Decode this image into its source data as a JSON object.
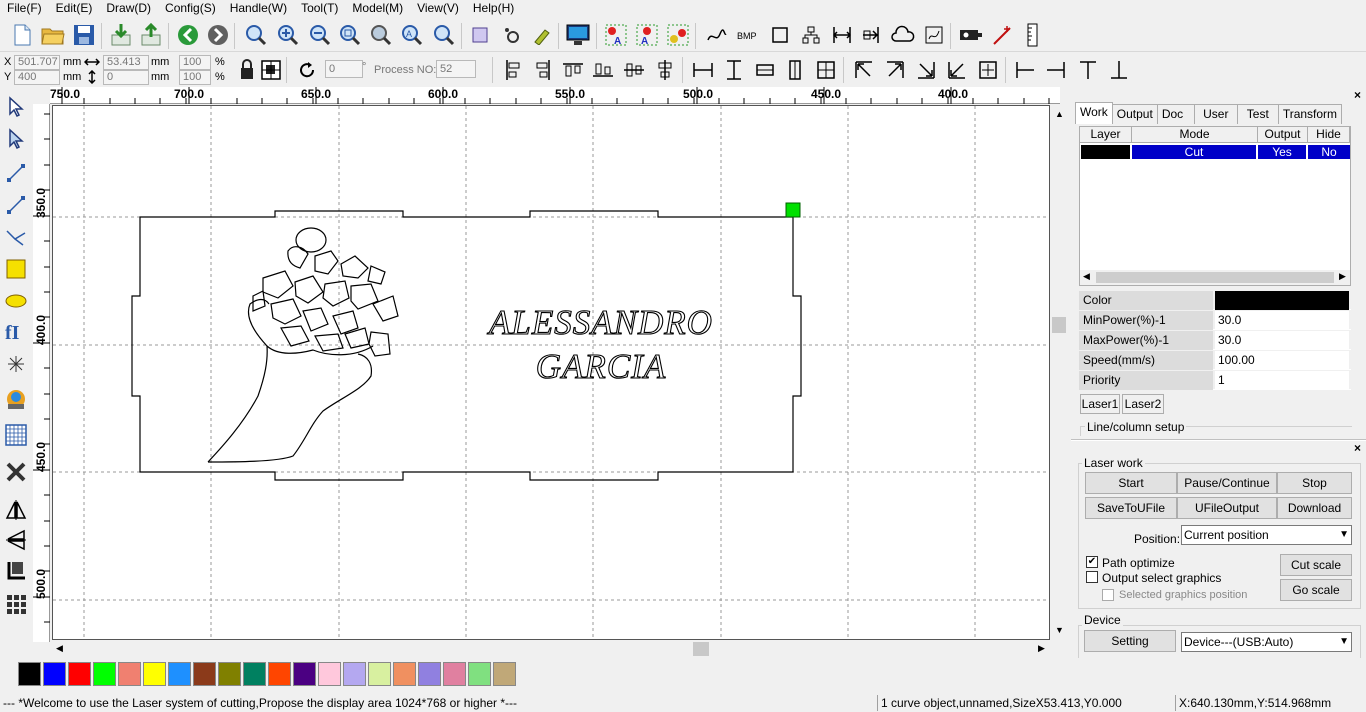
{
  "menu": [
    "File(F)",
    "Edit(E)",
    "Draw(D)",
    "Config(S)",
    "Handle(W)",
    "Tool(T)",
    "Model(M)",
    "View(V)",
    "Help(H)"
  ],
  "toolbar2": {
    "x_label": "X",
    "x_value": "501.707",
    "x_unit": "mm",
    "y_label": "Y",
    "y_value": "400",
    "y_unit": "mm",
    "w_value": "53.413",
    "w_unit": "mm",
    "h_value": "0",
    "h_unit": "mm",
    "w_percent": "100",
    "h_percent": "100",
    "percent_sign": "%",
    "rotate_value": "0",
    "degree_sign": "°",
    "process_label": "Process NO:",
    "process_value": "52"
  },
  "ruler": {
    "h_labels": [
      "750.0",
      "700.0",
      "650.0",
      "600.0",
      "550.0",
      "500.0",
      "450.0",
      "400.0"
    ],
    "v_labels": [
      "350.0",
      "400.0",
      "450.0",
      "500.0"
    ]
  },
  "design": {
    "line1": "ALESSANDRO",
    "line2": "GARCIA"
  },
  "panel": {
    "tabs": [
      "Work",
      "Output",
      "Doc",
      "User",
      "Test",
      "Transform"
    ],
    "layer_headers": [
      "Layer",
      "Mode",
      "Output",
      "Hide"
    ],
    "layer_row": {
      "color": "#000000",
      "mode": "Cut",
      "output": "Yes",
      "hide": "No"
    },
    "props": [
      {
        "k": "Color",
        "v": ""
      },
      {
        "k": "MinPower(%)-1",
        "v": "30.0"
      },
      {
        "k": "MaxPower(%)-1",
        "v": "30.0"
      },
      {
        "k": "Speed(mm/s)",
        "v": "100.00"
      },
      {
        "k": "Priority",
        "v": "1"
      }
    ],
    "laser_tabs": [
      "Laser1",
      "Laser2"
    ],
    "line_column": "Line/column setup",
    "laser_work": "Laser work",
    "btn_start": "Start",
    "btn_pause": "Pause/Continue",
    "btn_stop": "Stop",
    "btn_save": "SaveToUFile",
    "btn_ufile": "UFileOutput",
    "btn_download": "Download",
    "position_label": "Position:",
    "position_value": "Current position",
    "path_optimize": "Path optimize",
    "output_select": "Output select graphics",
    "selected_pos": "Selected graphics position",
    "cut_scale": "Cut scale",
    "go_scale": "Go scale",
    "device_label": "Device",
    "setting": "Setting",
    "device_value": "Device---(USB:Auto)"
  },
  "palette": [
    "#000000",
    "#0000ff",
    "#ff0000",
    "#00ff00",
    "#f08070",
    "#ffff00",
    "#1e90ff",
    "#8b3a1a",
    "#808000",
    "#008060",
    "#ff4500",
    "#4b0082",
    "#ffc8dc",
    "#b4a8f0",
    "#d8f0a0",
    "#f09060",
    "#9080e0",
    "#e080a0",
    "#80e080",
    "#c0a878"
  ],
  "status": {
    "welcome": "--- *Welcome to use the Laser system of cutting,Propose the display area 1024*768 or higher *---",
    "object": "1 curve object,unnamed,SizeX53.413,Y0.000",
    "coords": "X:640.130mm,Y:514.968mm"
  }
}
